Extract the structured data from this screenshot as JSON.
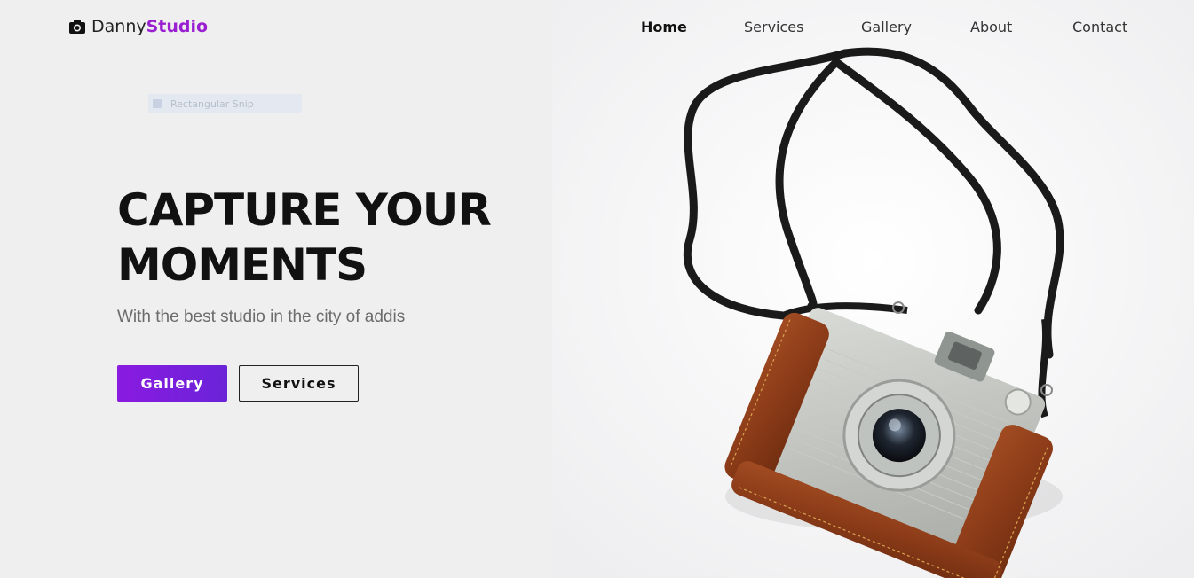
{
  "brand": {
    "name": "Danny",
    "accent": "Studio",
    "icon": "camera-icon",
    "accent_color": "#9a1fd0"
  },
  "nav": {
    "items": [
      {
        "label": "Home",
        "active": true
      },
      {
        "label": "Services",
        "active": false
      },
      {
        "label": "Gallery",
        "active": false
      },
      {
        "label": "About",
        "active": false
      },
      {
        "label": "Contact",
        "active": false
      }
    ]
  },
  "overlay": {
    "snip_label": "Rectangular Snip"
  },
  "hero": {
    "title": "CAPTURE YOUR MOMENTS",
    "subtitle": "With the best studio in the city of addis",
    "primary_button": "Gallery",
    "secondary_button": "Services",
    "button_gradient": [
      "#8a1ae0",
      "#6a24d8"
    ],
    "image": "vintage-camera-photo"
  }
}
